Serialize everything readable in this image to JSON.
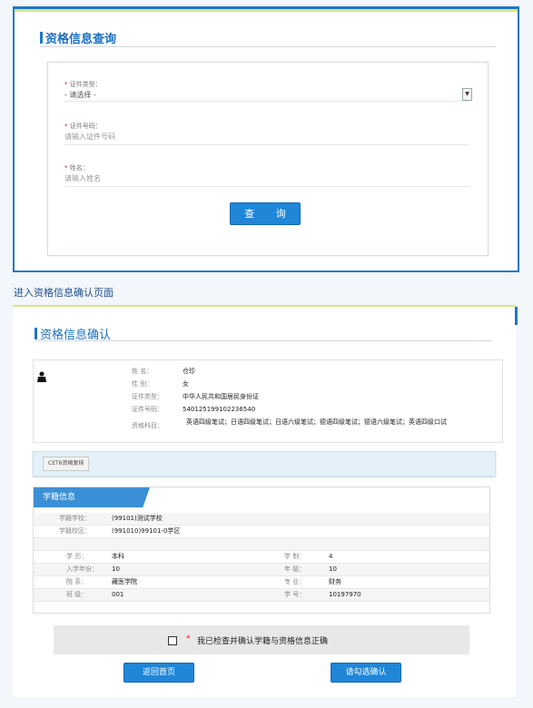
{
  "query": {
    "title": "资格信息查询",
    "type_label": "证件类型：",
    "type_value": "- 请选择 -",
    "id_label": "证件号码：",
    "id_placeholder": "请输入证件号码",
    "name_label": "姓名：",
    "name_placeholder": "请输入姓名",
    "button": "查 询"
  },
  "caption": "进入资格信息确认页面",
  "confirm": {
    "title": "资格信息确认",
    "person": [
      {
        "k": "姓    名：",
        "v": "仓珍"
      },
      {
        "k": "性    别：",
        "v": "女"
      },
      {
        "k": "证件类型：",
        "v": "中华人民共和国居民身份证"
      },
      {
        "k": "证件号码：",
        "v": "540125199102236540"
      }
    ],
    "subjects_label": "资格科目：",
    "subjects_value": "英语四级笔试；日语四级笔试；日语六级笔试；德语四级笔试；德语六级笔试；英语四级口试",
    "cet_button": "CET6资格复核",
    "xueji": {
      "tab": "学籍信息",
      "school_label": "学籍学校：",
      "school_value": "(99101)测试学校",
      "campus_label": "学籍校区：",
      "campus_value": "(991010)99101-0学区",
      "rows": [
        {
          "k1": "学    历：",
          "v1": "本科",
          "k2": "学    制：",
          "v2": "4"
        },
        {
          "k1": "入学年份：",
          "v1": "10",
          "k2": "年    级：",
          "v2": "10"
        },
        {
          "k1": "院    系：",
          "v1": "藏医学院",
          "k2": "专    业：",
          "v2": "财务"
        },
        {
          "k1": "班    级：",
          "v1": "001",
          "k2": "学    号：",
          "v2": "10197970"
        }
      ]
    },
    "agree_star": "*",
    "agree_text": "我已检查并确认学籍与资格信息正确",
    "home_button": "返回首页",
    "check_button": "请勾选确认"
  }
}
